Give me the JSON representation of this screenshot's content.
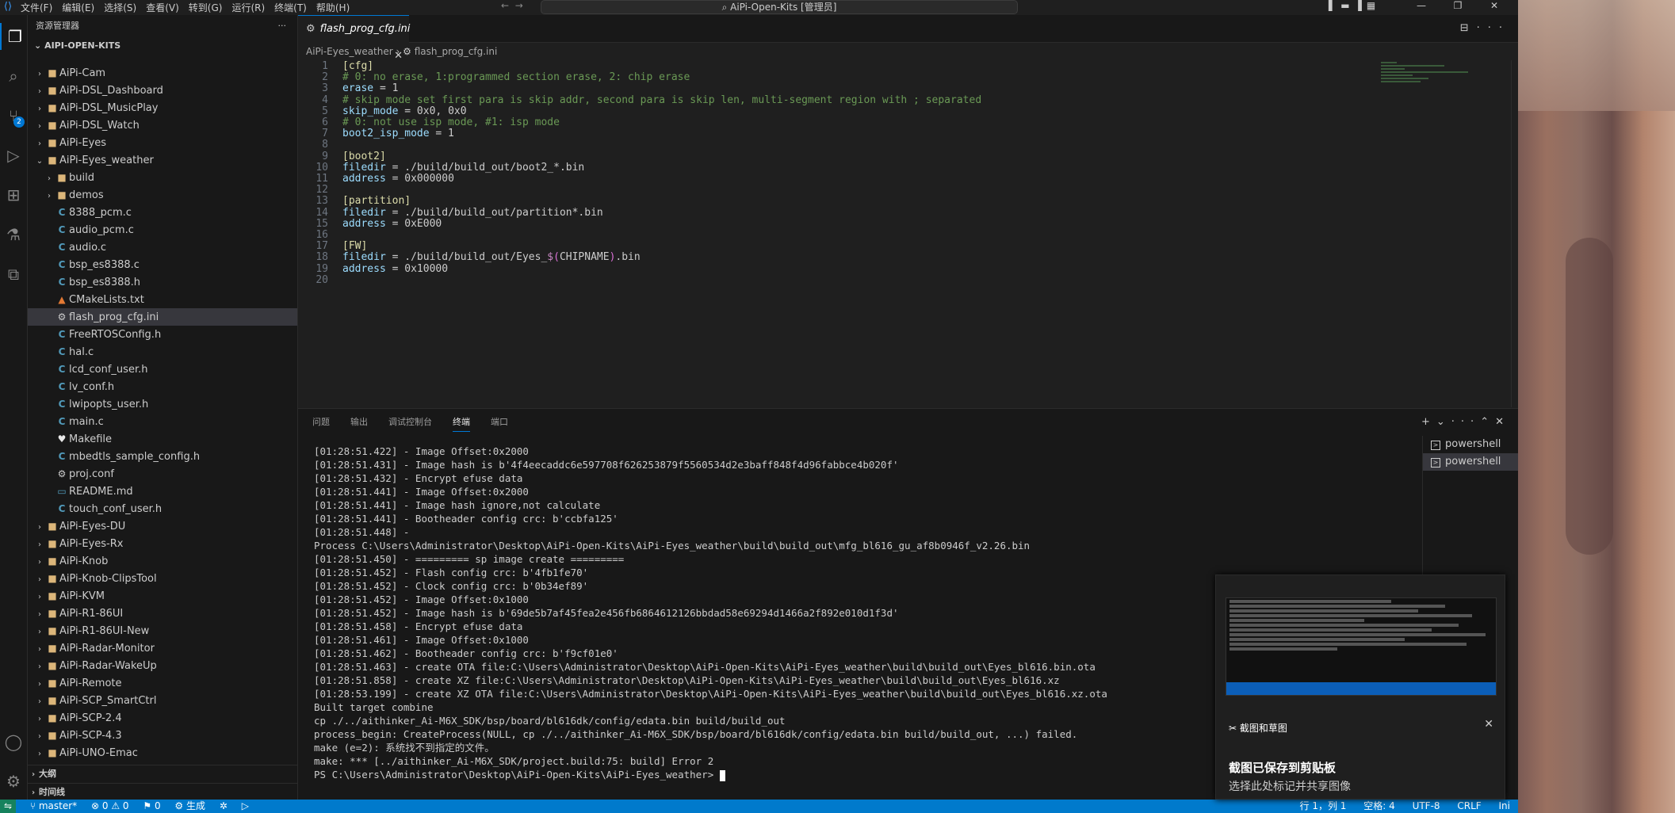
{
  "titlebar": {
    "menus": [
      "文件(F)",
      "编辑(E)",
      "选择(S)",
      "查看(V)",
      "转到(G)",
      "运行(R)",
      "终端(T)",
      "帮助(H)"
    ],
    "command_center": "AiPi-Open-Kits [管理员]"
  },
  "activity": {
    "source_control_badge": "2"
  },
  "explorer": {
    "header": "资源管理器",
    "root": "AIPI-OPEN-KITS",
    "items": [
      {
        "label": "AiPi-Cam",
        "kind": "folder",
        "indent": 1
      },
      {
        "label": "AiPi-DSL_Dashboard",
        "kind": "folder",
        "indent": 1
      },
      {
        "label": "AiPi-DSL_MusicPlay",
        "kind": "folder",
        "indent": 1
      },
      {
        "label": "AiPi-DSL_Watch",
        "kind": "folder",
        "indent": 1
      },
      {
        "label": "AiPi-Eyes",
        "kind": "folder",
        "indent": 1
      },
      {
        "label": "AiPi-Eyes_weather",
        "kind": "folder-open",
        "indent": 1
      },
      {
        "label": "build",
        "kind": "folder",
        "indent": 2
      },
      {
        "label": "demos",
        "kind": "folder",
        "indent": 2
      },
      {
        "label": "8388_pcm.c",
        "kind": "c",
        "indent": 2
      },
      {
        "label": "audio_pcm.c",
        "kind": "c",
        "indent": 2
      },
      {
        "label": "audio.c",
        "kind": "c",
        "indent": 2
      },
      {
        "label": "bsp_es8388.c",
        "kind": "c",
        "indent": 2
      },
      {
        "label": "bsp_es8388.h",
        "kind": "c",
        "indent": 2
      },
      {
        "label": "CMakeLists.txt",
        "kind": "cmake",
        "indent": 2
      },
      {
        "label": "flash_prog_cfg.ini",
        "kind": "gear",
        "indent": 2,
        "selected": true
      },
      {
        "label": "FreeRTOSConfig.h",
        "kind": "c",
        "indent": 2
      },
      {
        "label": "hal.c",
        "kind": "c",
        "indent": 2
      },
      {
        "label": "lcd_conf_user.h",
        "kind": "c",
        "indent": 2
      },
      {
        "label": "lv_conf.h",
        "kind": "c",
        "indent": 2
      },
      {
        "label": "lwipopts_user.h",
        "kind": "c",
        "indent": 2
      },
      {
        "label": "main.c",
        "kind": "c",
        "indent": 2
      },
      {
        "label": "Makefile",
        "kind": "make",
        "indent": 2
      },
      {
        "label": "mbedtls_sample_config.h",
        "kind": "c",
        "indent": 2
      },
      {
        "label": "proj.conf",
        "kind": "gear",
        "indent": 2
      },
      {
        "label": "README.md",
        "kind": "md",
        "indent": 2
      },
      {
        "label": "touch_conf_user.h",
        "kind": "c",
        "indent": 2
      },
      {
        "label": "AiPi-Eyes-DU",
        "kind": "folder",
        "indent": 1
      },
      {
        "label": "AiPi-Eyes-Rx",
        "kind": "folder",
        "indent": 1
      },
      {
        "label": "AiPi-Knob",
        "kind": "folder",
        "indent": 1
      },
      {
        "label": "AiPi-Knob-ClipsTool",
        "kind": "folder",
        "indent": 1
      },
      {
        "label": "AiPi-KVM",
        "kind": "folder",
        "indent": 1
      },
      {
        "label": "AiPi-R1-86UI",
        "kind": "folder",
        "indent": 1
      },
      {
        "label": "AiPi-R1-86UI-New",
        "kind": "folder",
        "indent": 1
      },
      {
        "label": "AiPi-Radar-Monitor",
        "kind": "folder",
        "indent": 1
      },
      {
        "label": "AiPi-Radar-WakeUp",
        "kind": "folder",
        "indent": 1
      },
      {
        "label": "AiPi-Remote",
        "kind": "folder",
        "indent": 1
      },
      {
        "label": "AiPi-SCP_SmartCtrl",
        "kind": "folder",
        "indent": 1
      },
      {
        "label": "AiPi-SCP-2.4",
        "kind": "folder",
        "indent": 1
      },
      {
        "label": "AiPi-SCP-4.3",
        "kind": "folder",
        "indent": 1
      },
      {
        "label": "AiPi-UNO-Emac",
        "kind": "folder",
        "indent": 1
      }
    ],
    "outline": "大纲",
    "timeline": "时间线"
  },
  "editor": {
    "tab_label": "flash_prog_cfg.ini",
    "breadcrumb_folder": "AiPi-Eyes_weather",
    "breadcrumb_file": "flash_prog_cfg.ini",
    "lines": [
      {
        "n": "1",
        "t": "sec",
        "text": "[cfg]"
      },
      {
        "n": "2",
        "t": "cmt",
        "text": "# 0: no erase, 1:programmed section erase, 2: chip erase"
      },
      {
        "n": "3",
        "t": "kv",
        "key": "erase",
        "val": " = 1"
      },
      {
        "n": "4",
        "t": "cmt",
        "text": "# skip mode set first para is skip addr, second para is skip len, multi-segment region with ; separated"
      },
      {
        "n": "5",
        "t": "kv",
        "key": "skip_mode",
        "val": " = 0x0, 0x0"
      },
      {
        "n": "6",
        "t": "cmt",
        "text": "# 0: not use isp mode, #1: isp mode"
      },
      {
        "n": "7",
        "t": "kv",
        "key": "boot2_isp_mode",
        "val": " = 1"
      },
      {
        "n": "8",
        "t": "blank",
        "text": ""
      },
      {
        "n": "9",
        "t": "sec",
        "text": "[boot2]"
      },
      {
        "n": "10",
        "t": "kv",
        "key": "filedir",
        "val": " = ./build/build_out/boot2_*.bin"
      },
      {
        "n": "11",
        "t": "kv",
        "key": "address",
        "val": " = 0x000000"
      },
      {
        "n": "12",
        "t": "blank",
        "text": ""
      },
      {
        "n": "13",
        "t": "sec",
        "text": "[partition]"
      },
      {
        "n": "14",
        "t": "kv",
        "key": "filedir",
        "val": " = ./build/build_out/partition*.bin"
      },
      {
        "n": "15",
        "t": "kv",
        "key": "address",
        "val": " = 0xE000"
      },
      {
        "n": "16",
        "t": "blank",
        "text": ""
      },
      {
        "n": "17",
        "t": "sec",
        "text": "[FW]"
      },
      {
        "n": "18",
        "t": "kvm",
        "key": "filedir",
        "pre": " = ./build/build_out/Eyes_",
        "macro": "$",
        "br1": "(",
        "mid": "CHIPNAME",
        "br2": ")",
        "post": ".bin"
      },
      {
        "n": "19",
        "t": "kv",
        "key": "address",
        "val": " = 0x10000"
      },
      {
        "n": "20",
        "t": "blank",
        "text": ""
      }
    ]
  },
  "panel": {
    "tabs": [
      "问题",
      "输出",
      "调试控制台",
      "终端",
      "端口"
    ],
    "active_tab": "终端",
    "terminals": [
      "powershell",
      "powershell"
    ],
    "terminal_lines": [
      "[01:28:51.422] - Image Offset:0x2000",
      "[01:28:51.431] - Image hash is b'4f4eecaddc6e597708f626253879f5560534d2e3baff848f4d96fabbce4b020f'",
      "[01:28:51.432] - Encrypt efuse data",
      "[01:28:51.441] - Image Offset:0x2000",
      "[01:28:51.441] - Image hash ignore,not calculate",
      "[01:28:51.441] - Bootheader config crc: b'ccbfa125'",
      "[01:28:51.448] -",
      "Process C:\\Users\\Administrator\\Desktop\\AiPi-Open-Kits\\AiPi-Eyes_weather\\build\\build_out\\mfg_bl616_gu_af8b0946f_v2.26.bin",
      "[01:28:51.450] - ========= sp image create =========",
      "[01:28:51.452] - Flash config crc: b'4fb1fe70'",
      "[01:28:51.452] - Clock config crc: b'0b34ef89'",
      "[01:28:51.452] - Image Offset:0x1000",
      "[01:28:51.452] - Image hash is b'69de5b7af45fea2e456fb6864612126bbdad58e69294d1466a2f892e010d1f3d'",
      "[01:28:51.458] - Encrypt efuse data",
      "[01:28:51.461] - Image Offset:0x1000",
      "[01:28:51.462] - Bootheader config crc: b'f9cf01e0'",
      "[01:28:51.463] - create OTA file:C:\\Users\\Administrator\\Desktop\\AiPi-Open-Kits\\AiPi-Eyes_weather\\build\\build_out\\Eyes_bl616.bin.ota",
      "[01:28:51.858] - create XZ file:C:\\Users\\Administrator\\Desktop\\AiPi-Open-Kits\\AiPi-Eyes_weather\\build\\build_out\\Eyes_bl616.xz",
      "[01:28:53.199] - create XZ OTA file:C:\\Users\\Administrator\\Desktop\\AiPi-Open-Kits\\AiPi-Eyes_weather\\build\\build_out\\Eyes_bl616.xz.ota",
      "Built target combine",
      "cp ./../aithinker_Ai-M6X_SDK/bsp/board/bl616dk/config/edata.bin build/build_out",
      "process_begin: CreateProcess(NULL, cp ./../aithinker_Ai-M6X_SDK/bsp/board/bl616dk/config/edata.bin build/build_out, ...) failed.",
      "make (e=2): 系统找不到指定的文件。",
      "make: *** [../aithinker_Ai-M6X_SDK/project.build:75: build] Error 2"
    ],
    "prompt": "PS C:\\Users\\Administrator\\Desktop\\AiPi-Open-Kits\\AiPi-Eyes_weather> "
  },
  "statusbar": {
    "branch": "master*",
    "errors": "0",
    "warnings": "0",
    "ports": "0",
    "build": "生成",
    "position": "行 1，列 1",
    "spaces": "空格: 4",
    "encoding": "UTF-8",
    "eol": "CRLF",
    "language": "Ini"
  },
  "notification": {
    "app": "截图和草图",
    "title": "截图已保存到剪贴板",
    "subtitle": "选择此处标记并共享图像"
  }
}
